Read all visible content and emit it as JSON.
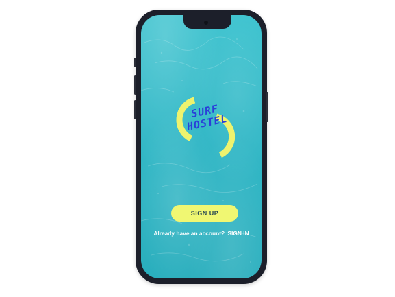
{
  "app": {
    "name_line_1": "SURF",
    "name_line_2": "HOSTEL"
  },
  "actions": {
    "signup_label": "SIGN UP",
    "signin_prompt": "Already have an account?",
    "signin_link": "SIGN IN"
  },
  "colors": {
    "water": "#30b7c6",
    "accent_yellow": "#f0f772",
    "logo_blue": "#2a3fd8",
    "phone_frame": "#1c1f2a"
  }
}
